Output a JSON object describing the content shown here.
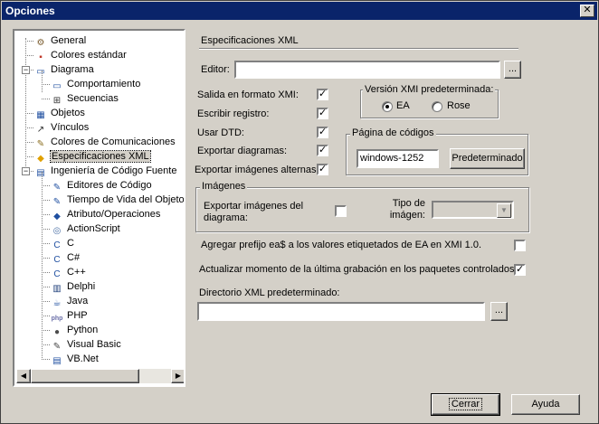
{
  "window": {
    "title": "Opciones",
    "close_glyph": "✕"
  },
  "tree": {
    "items": [
      {
        "label": "General",
        "icon": "general-icon",
        "glyph": "⚙",
        "color": "#7a5c2e"
      },
      {
        "label": "Colores estándar",
        "icon": "colors-icon",
        "glyph": "▪",
        "color": "#c0392b"
      },
      {
        "label": "Diagrama",
        "icon": "diagram-icon",
        "glyph": "▭",
        "color": "#1f4fa0"
      },
      {
        "label": "Comportamiento",
        "icon": "behavior-icon",
        "glyph": "▭",
        "color": "#1f4fa0"
      },
      {
        "label": "Secuencias",
        "icon": "sequence-icon",
        "glyph": "⊞",
        "color": "#333333"
      },
      {
        "label": "Objetos",
        "icon": "objects-icon",
        "glyph": "▦",
        "color": "#1f4fa0"
      },
      {
        "label": "Vínculos",
        "icon": "links-icon",
        "glyph": "↗",
        "color": "#333333"
      },
      {
        "label": "Colores de Comunicaciones",
        "icon": "comm-colors-icon",
        "glyph": "✎",
        "color": "#8a6d1e"
      },
      {
        "label": "Especificaciones XML",
        "icon": "xml-icon",
        "glyph": "◆",
        "color": "#e0a000"
      },
      {
        "label": "Ingeniería de Código Fuente",
        "icon": "source-code-icon",
        "glyph": "▤",
        "color": "#1f4fa0"
      },
      {
        "label": "Editores de Código",
        "icon": "code-editor-icon",
        "glyph": "✎",
        "color": "#1f4fa0"
      },
      {
        "label": "Tiempo de Vida del Objeto",
        "icon": "object-lifetime-icon",
        "glyph": "✎",
        "color": "#1f4fa0"
      },
      {
        "label": "Atributo/Operaciones",
        "icon": "attribute-icon",
        "glyph": "◆",
        "color": "#1f4fa0"
      },
      {
        "label": "ActionScript",
        "icon": "actionscript-icon",
        "glyph": "◎",
        "color": "#4a6fa5"
      },
      {
        "label": "C",
        "icon": "c-icon",
        "glyph": "C",
        "color": "#1f4fa0"
      },
      {
        "label": "C#",
        "icon": "csharp-icon",
        "glyph": "C",
        "color": "#1f4fa0"
      },
      {
        "label": "C++",
        "icon": "cpp-icon",
        "glyph": "C",
        "color": "#1f4fa0"
      },
      {
        "label": "Delphi",
        "icon": "delphi-icon",
        "glyph": "▥",
        "color": "#1f3f7a"
      },
      {
        "label": "Java",
        "icon": "java-icon",
        "glyph": "☕",
        "color": "#1f4fa0"
      },
      {
        "label": "PHP",
        "icon": "php-icon",
        "glyph": "php",
        "color": "#6a6fa8"
      },
      {
        "label": "Python",
        "icon": "python-icon",
        "glyph": "●",
        "color": "#4b4b4b"
      },
      {
        "label": "Visual Basic",
        "icon": "visual-basic-icon",
        "glyph": "✎",
        "color": "#444444"
      },
      {
        "label": "VB.Net",
        "icon": "vbnet-icon",
        "glyph": "▤",
        "color": "#1f4fa0"
      }
    ]
  },
  "section_title": "Especificaciones XML",
  "editor": {
    "label": "Editor:",
    "value": "",
    "browse": "..."
  },
  "options": [
    {
      "label": "Salida en formato XMI:",
      "checked": true
    },
    {
      "label": "Escribir registro:",
      "checked": true
    },
    {
      "label": "Usar DTD:",
      "checked": true
    },
    {
      "label": "Exportar diagramas:",
      "checked": true
    },
    {
      "label": "Exportar imágenes alternas:",
      "checked": true
    }
  ],
  "xmi_version": {
    "title": "Versión XMI predeterminada:",
    "ea": "EA",
    "rose": "Rose",
    "selected": "EA"
  },
  "codepage": {
    "title": "Página de códigos",
    "value": "windows-1252",
    "button": "Predeterminado"
  },
  "images": {
    "title": "Imágenes",
    "export_label": "Exportar imágenes del diagrama:",
    "export_checked": false,
    "type_label": "Tipo de imágen:",
    "type_value": ""
  },
  "prefix_option": {
    "label": "Agregar prefijo ea$ a los valores etiquetados de EA en XMI 1.0.",
    "checked": false
  },
  "update_option": {
    "label": "Actualizar momento de la última grabación en los paquetes controlados.",
    "checked": true
  },
  "xml_dir": {
    "label": "Directorio XML predeterminado:",
    "value": "",
    "browse": "..."
  },
  "buttons": {
    "ok": "Cerrar",
    "help": "Ayuda"
  }
}
